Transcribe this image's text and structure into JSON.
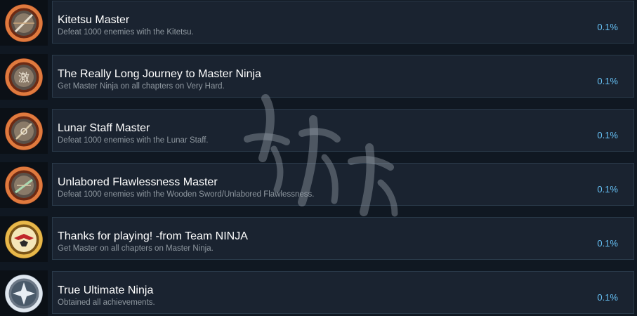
{
  "achievements": [
    {
      "title": "Kitetsu Master",
      "description": "Defeat 1000 enemies with the Kitetsu.",
      "percent": "0.1%",
      "icon": "bronze-sword-medal-icon"
    },
    {
      "title": "The Really Long Journey to Master Ninja",
      "description": "Get Master Ninja on all chapters on Very Hard.",
      "percent": "0.1%",
      "icon": "bronze-kanji-medal-icon"
    },
    {
      "title": "Lunar Staff Master",
      "description": "Defeat 1000 enemies with the Lunar Staff.",
      "percent": "0.1%",
      "icon": "bronze-staff-medal-icon"
    },
    {
      "title": "Unlabored Flawlessness Master",
      "description": "Defeat 1000 enemies with the Wooden Sword/Unlabored Flawlessness.",
      "percent": "0.1%",
      "icon": "bronze-wooden-sword-medal-icon"
    },
    {
      "title": "Thanks for playing! -from Team NINJA",
      "description": "Get Master on all chapters on Master Ninja.",
      "percent": "0.1%",
      "icon": "gold-ninja-medal-icon"
    },
    {
      "title": "True Ultimate Ninja",
      "description": "Obtained all achievements.",
      "percent": "0.1%",
      "icon": "platinum-medal-icon"
    }
  ],
  "colors": {
    "title": "#ffffff",
    "description": "#8f98a0",
    "percent": "#66c0f4",
    "panel": "#1a2330",
    "bronze": "#b8562a",
    "gold": "#d9a437",
    "platinum": "#c9d3de"
  },
  "watermark": {
    "icon": "chinese-calligraphy-watermark-icon"
  }
}
